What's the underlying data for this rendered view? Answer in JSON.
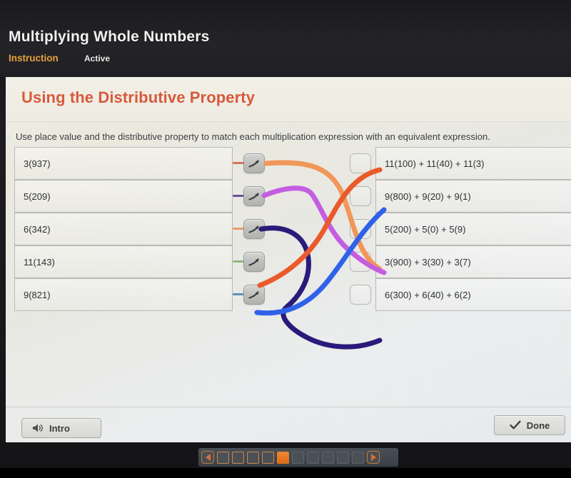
{
  "header": {
    "lesson_title": "Multiplying Whole Numbers",
    "breadcrumb_instruction": "Instruction",
    "breadcrumb_active": "Active"
  },
  "page": {
    "title": "Using the Distributive Property",
    "prompt": "Use place value and the distributive property to match each multiplication expression with an equivalent expression."
  },
  "colors": {
    "title_orange": "#d9593c",
    "breadcrumb_gold": "#e8a23c",
    "current_pip": "#e8772a"
  },
  "matcher": {
    "left_items": [
      {
        "label": "3(937)",
        "stub_color": "#d9705e"
      },
      {
        "label": "5(209)",
        "stub_color": "#6b4f9e"
      },
      {
        "label": "6(342)",
        "stub_color": "#e99a6a"
      },
      {
        "label": "11(143)",
        "stub_color": "#8cba7e"
      },
      {
        "label": "9(821)",
        "stub_color": "#5b93b5"
      }
    ],
    "right_items": [
      {
        "label": "11(100) + 11(40) + 11(3)"
      },
      {
        "label": "9(800) + 9(20) + 9(1)"
      },
      {
        "label": "5(200) + 5(0) + 5(9)"
      },
      {
        "label": "3(900) + 3(30) + 3(7)"
      },
      {
        "label": "6(300) + 6(40) + 6(2)"
      }
    ],
    "connections": [
      {
        "from": "3(937)",
        "to": "3(900) + 3(30) + 3(7)",
        "color": "#f1975a"
      },
      {
        "from": "5(209)",
        "to": "5(200) + 5(0) + 5(9)",
        "color": "#c45ee0"
      },
      {
        "from": "6(342)",
        "to": "6(300) + 6(40) + 6(2)",
        "color": "#2b1a7a"
      },
      {
        "from": "11(143)",
        "to": "11(100) + 11(40) + 11(3)",
        "color": "#ea5a2a"
      },
      {
        "from": "9(821)",
        "to": "9(800) + 9(20) + 9(1)",
        "color": "#2f62e8"
      }
    ],
    "arrow_icon": "arrow-up-right-icon"
  },
  "footer": {
    "intro_label": "Intro",
    "intro_icon": "speaker-icon",
    "done_label": "Done",
    "done_icon": "checkmark-icon"
  },
  "bottom_nav": {
    "prev_icon": "triangle-left-icon",
    "next_icon": "triangle-right-icon",
    "total_steps": 10,
    "current_step": 5,
    "pips": [
      "done",
      "done",
      "done",
      "done",
      "current",
      "todo",
      "todo",
      "todo",
      "todo",
      "todo"
    ]
  }
}
